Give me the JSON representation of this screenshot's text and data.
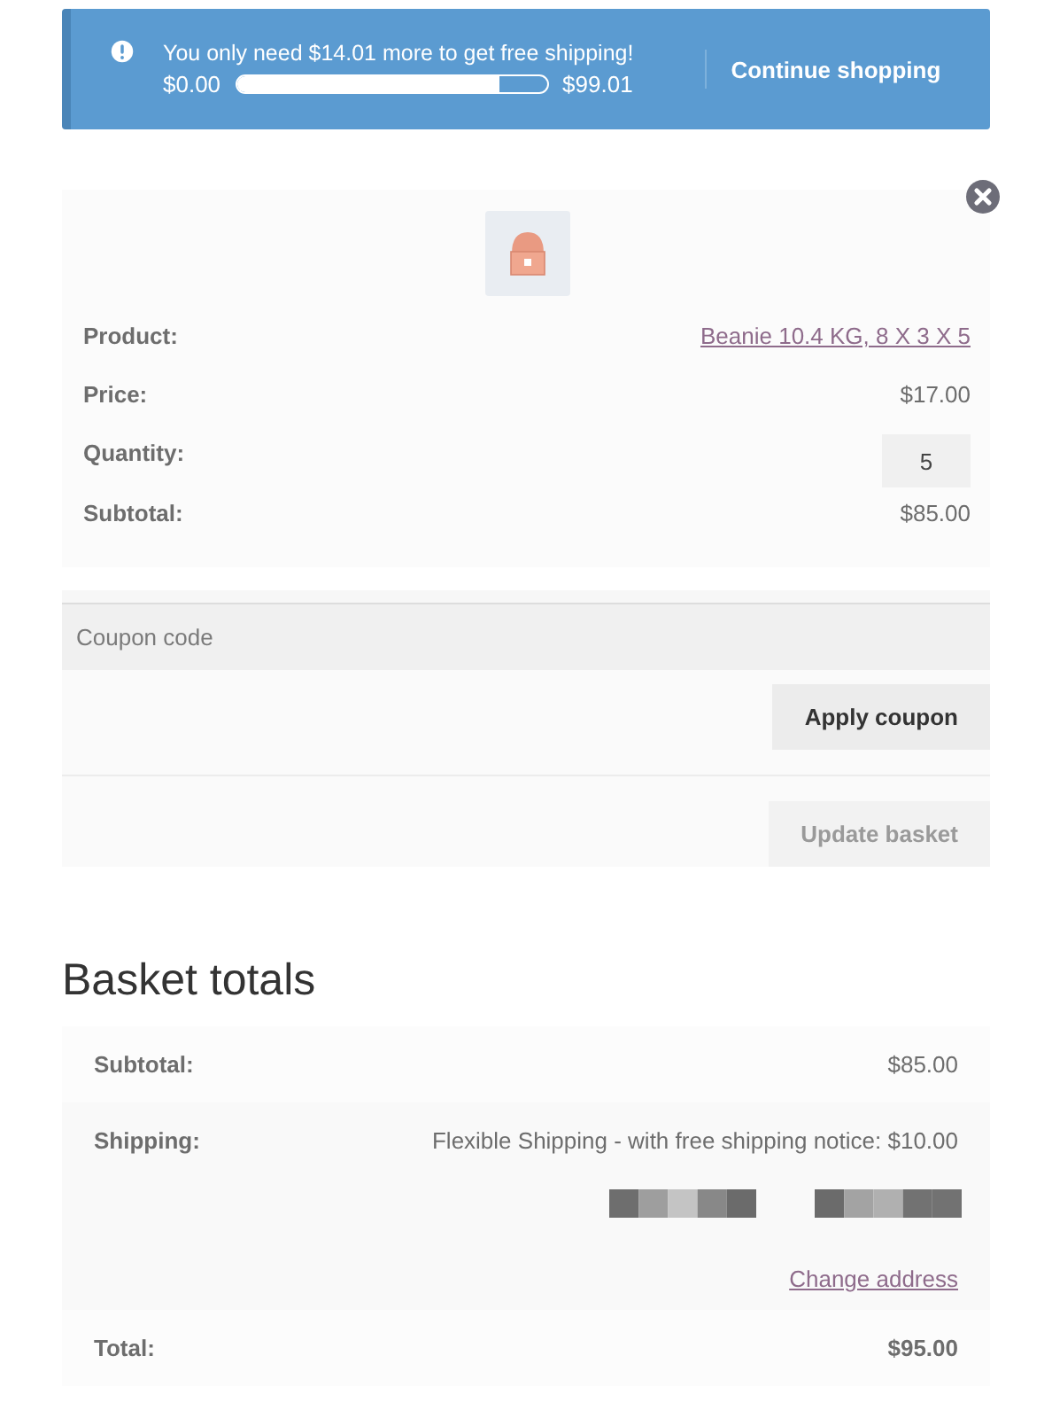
{
  "notice": {
    "message": "You only need $14.01 more to get free shipping!",
    "min": "$0.00",
    "max": "$99.01",
    "level": 0.85,
    "action": "Continue shopping"
  },
  "cart_item": {
    "kind": "picture",
    "fields": [
      {
        "label": "Product:",
        "value": "Beanie 10.4 KG, 8 X 3 X 5",
        "kind": "link"
      },
      {
        "label": "Price:",
        "value": "$17.00",
        "kind": "text"
      },
      {
        "label": "Quantity:",
        "value": "5",
        "kind": "quantity"
      },
      {
        "label": "Subtotal:",
        "value": "$85.00",
        "kind": "text"
      }
    ]
  },
  "coupon": {
    "placeholder": "Coupon code",
    "apply": "Apply coupon",
    "update": "Update basket",
    "update_disabled": true
  },
  "totals": {
    "title": "Basket totals",
    "rows": [
      {
        "label": "Subtotal:",
        "value": "$85.00",
        "kind": "text"
      },
      {
        "label": "Shipping:",
        "value": "Flexible Shipping - with free shipping notice: $10.00",
        "kind": "shipping",
        "link": "Change address"
      },
      {
        "label": "Total:",
        "value": "$95.00",
        "kind": "total"
      }
    ]
  }
}
